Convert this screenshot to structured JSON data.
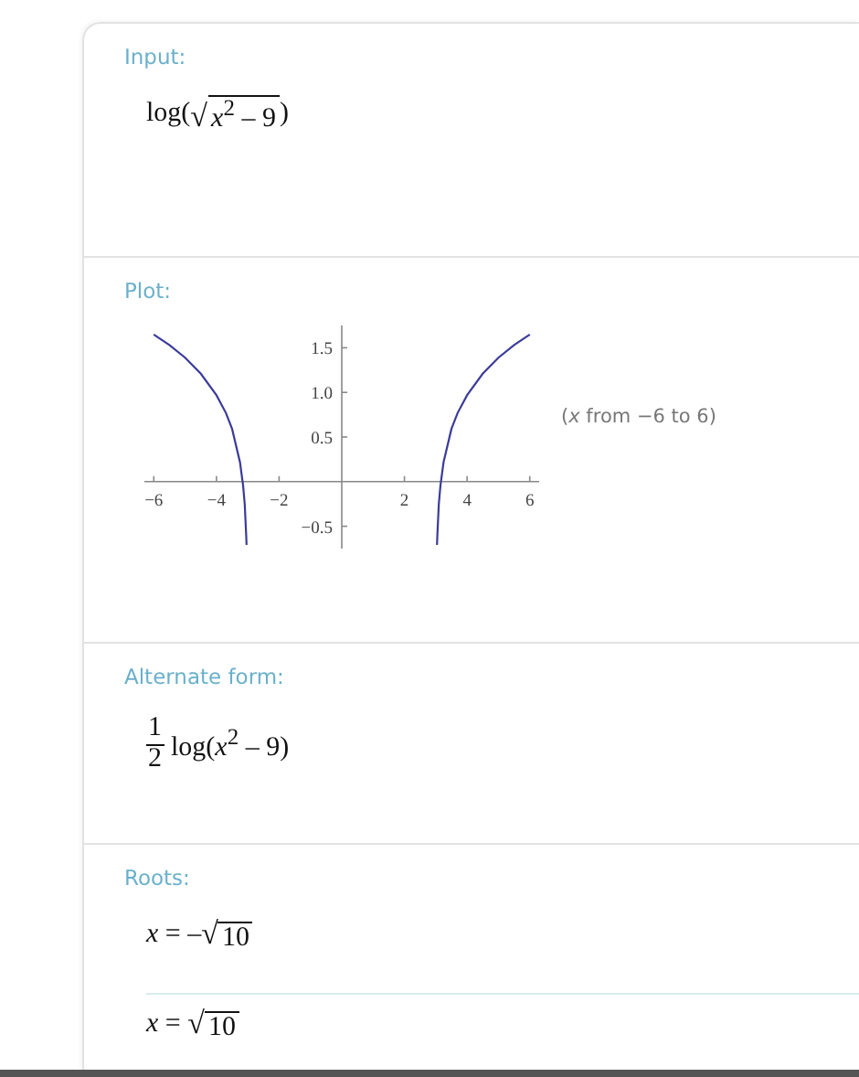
{
  "pods": [
    {
      "kind": "math",
      "label": "Input:",
      "results": [
        [
          {
            "kind": "text",
            "text": "log("
          },
          {
            "kind": "sqrt",
            "sign": "√",
            "text": "*x*$^{2}$ – 9"
          },
          {
            "kind": "text",
            "text": ")"
          }
        ]
      ]
    },
    {
      "kind": "plot",
      "label": "Plot:",
      "note": "(*x* from −6 to 6)",
      "chart_data": {
        "type": "line",
        "x": [
          -6,
          -5.5,
          -5,
          -4.5,
          -4,
          -3.7,
          -3.5,
          -3.25,
          -3.15,
          -3.1,
          -3.05,
          -3.04,
          3.04,
          3.05,
          3.1,
          3.15,
          3.25,
          3.5,
          3.7,
          4,
          4.5,
          5,
          5.5,
          6
        ],
        "series": [
          {
            "color": "#3b3b9a",
            "values": [
              1.65,
              1.53,
              1.39,
              1.21,
              0.97,
              0.77,
              0.59,
              0.22,
              -0.04,
              -0.25,
              -0.6,
              -0.71,
              -0.71,
              -0.6,
              -0.25,
              -0.04,
              0.22,
              0.59,
              0.77,
              0.97,
              1.21,
              1.39,
              1.53,
              1.65
            ]
          }
        ],
        "xlim": [
          -6.3,
          6.3
        ],
        "ylim": [
          -0.75,
          1.75
        ],
        "xticks": [
          {
            "value": -6,
            "label": "−6"
          },
          {
            "value": -4,
            "label": "−4"
          },
          {
            "value": -2,
            "label": "−2"
          },
          2,
          4,
          6
        ],
        "yticks": [
          {
            "value": -0.5,
            "label": "−0.5"
          },
          {
            "value": 0.5,
            "label": "0.5"
          },
          {
            "value": 1,
            "label": "1.0"
          },
          {
            "value": 1.5,
            "label": "1.5"
          }
        ]
      }
    },
    {
      "kind": "math",
      "label": "Alternate form:",
      "results": [
        [
          {
            "kind": "frac",
            "num": "1",
            "den": "2"
          },
          {
            "kind": "text",
            "text": "log(*x*$^{2}$ – 9)"
          }
        ]
      ]
    },
    {
      "kind": "math",
      "label": "Roots:",
      "results": [
        [
          {
            "kind": "text",
            "text": "*x* = –"
          },
          {
            "kind": "sqrt",
            "sign": "√",
            "text": "10"
          }
        ],
        [
          {
            "kind": "text",
            "text": "*x* = "
          },
          {
            "kind": "sqrt",
            "sign": "√",
            "text": "10"
          }
        ]
      ]
    }
  ]
}
